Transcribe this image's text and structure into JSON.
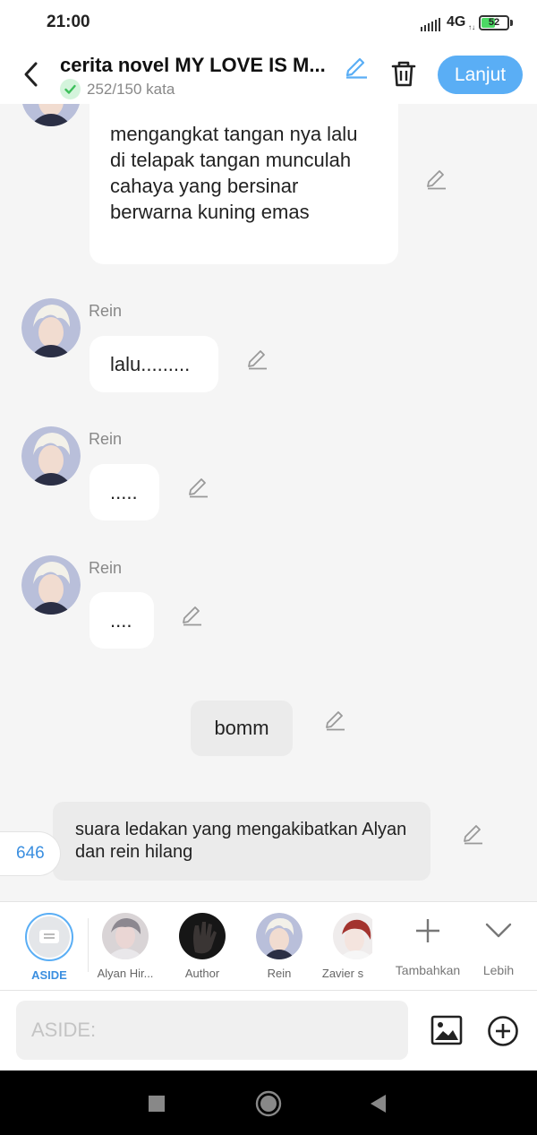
{
  "status_bar": {
    "time": "21:00",
    "network": "4G",
    "network_arrows": "↑↓",
    "battery": "52",
    "battery_level": 0.52
  },
  "header": {
    "title": "cerita novel MY LOVE IS M...",
    "word_count": "252/150 kata",
    "next_label": "Lanjut",
    "icons": [
      "back-icon",
      "pencil-icon",
      "check-icon",
      "trash-icon"
    ]
  },
  "chat": {
    "messages": [
      {
        "speaker": "",
        "text": "mengangkat tangan nya lalu di telapak tangan munculah cahaya yang bersinar berwarna kuning emas"
      },
      {
        "speaker": "Rein",
        "text": "lalu........."
      },
      {
        "speaker": "Rein",
        "text": "....."
      },
      {
        "speaker": "Rein",
        "text": "...."
      },
      {
        "speaker": "",
        "text": "bomm"
      },
      {
        "speaker": "",
        "text": "suara ledakan yang mengakibatkan Alyan dan rein hilang"
      }
    ],
    "counter": "646"
  },
  "characters": [
    {
      "label": "ASIDE",
      "active": true
    },
    {
      "label": "Alyan Hir...",
      "active": false
    },
    {
      "label": "Author",
      "active": false
    },
    {
      "label": "Rein",
      "active": false
    },
    {
      "label": "Zavier s",
      "active": false
    }
  ],
  "tools": {
    "add_label": "Tambahkan",
    "more_label": "Lebih"
  },
  "input": {
    "placeholder": "ASIDE:",
    "value": ""
  },
  "colors": {
    "accent": "#5aaef5",
    "bubble": "#ffffff",
    "narration_bubble": "#ebebeb",
    "background": "#f5f5f5",
    "battery_fill": "#4cd964"
  }
}
